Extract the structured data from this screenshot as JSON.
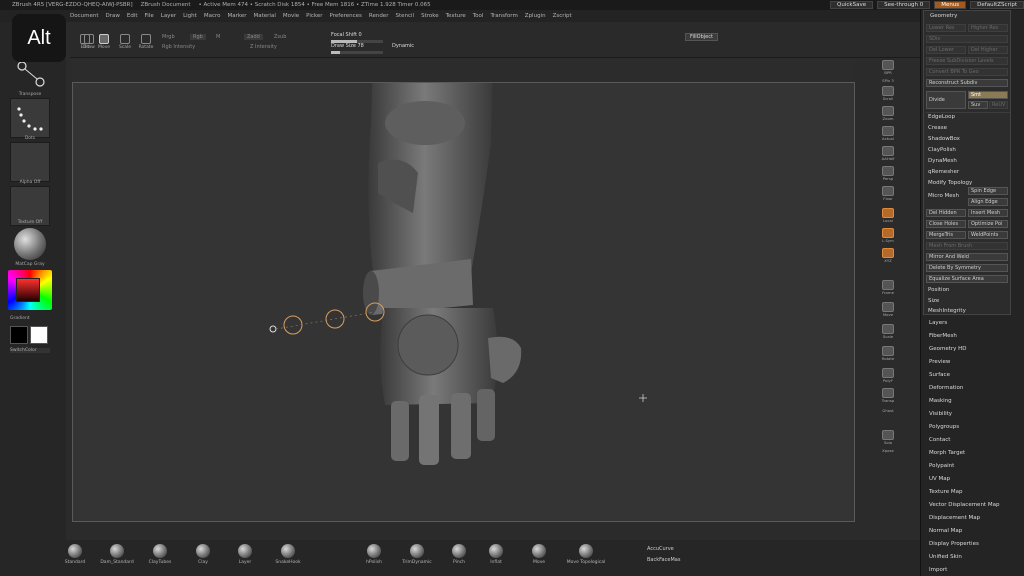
{
  "titlebar": {
    "app": "ZBrush 4R5 [VERG-EZDO-QHEQ-AIWJ-PSBR]",
    "doc": "ZBrush Document",
    "mem": "• Active Mem 474 • Scratch Disk 1854 • Free Mem 1816 • ZTime 1.928 Timer 0.065",
    "quicksave": "QuickSave",
    "seethrough": "See-through 0",
    "menus_btn": "Menus",
    "script": "DefaultZScript"
  },
  "menus": [
    "Document",
    "Draw",
    "Edit",
    "File",
    "Layer",
    "Light",
    "Macro",
    "Marker",
    "Material",
    "Movie",
    "Picker",
    "Preferences",
    "Render",
    "Stencil",
    "Stroke",
    "Texture",
    "Tool",
    "Transform",
    "Zplugin",
    "Zscript"
  ],
  "toolbar": {
    "edit": "Edit",
    "draw": "Draw",
    "move": "Move",
    "scale": "Scale",
    "rotate": "Rotate",
    "mrgb": "Mrgb",
    "rgb": "Rgb",
    "m": "M",
    "zadd": "Zadd",
    "zsub": "Zsub",
    "rgb_intensity": "Rgb Intensity",
    "z_intensity": "Z Intensity",
    "focal_shift": "Focal Shift 0",
    "draw_size": "Draw Size 78",
    "dynamic": "Dynamic",
    "fill_object": "FillObject"
  },
  "alt_key": "Alt",
  "leftshelf": {
    "transpose": "Transpose",
    "dots": "Dots",
    "alpha_off": "Alpha Off",
    "texture_off": "Texture Off",
    "material": "MatCap Gray",
    "gradient": "Gradient",
    "switchcolor": "SwitchColor"
  },
  "rightshelf": [
    "BPR",
    "SPix 3",
    "Scroll",
    "Zoom",
    "Actual",
    "AAHalf",
    "Persp",
    "Floor",
    "Local",
    "L.Sym",
    "XYZ",
    "Frame",
    "Move",
    "Scale",
    "Rotate",
    "PolyF",
    "Transp",
    "Ghost",
    "Solo",
    "Xpose"
  ],
  "geometry": {
    "title": "Geometry",
    "lower_res": "Lower Res",
    "higher_res": "Higher Res",
    "sdiv": "SDiv",
    "del_lower": "Del Lower",
    "del_higher": "Del Higher",
    "freeze": "Freeze SubDivision Levels",
    "convert_bpr": "Convert BPR To Geo",
    "reconstruct": "Reconstruct Subdiv",
    "divide": "Divide",
    "smt": "Smt",
    "suv": "Suv",
    "rsmt": "ReUV",
    "edgeloop": "EdgeLoop",
    "crease": "Crease",
    "shadowbox": "ShadowBox",
    "claypolish": "ClayPolish",
    "dynamesh": "DynaMesh",
    "qremesher": "qRemesher",
    "modify_topology": "Modify Topology",
    "micro_mesh": "Micro Mesh",
    "spin_edge": "Spin Edge",
    "align_edge": "Align Edge",
    "del_hidden": "Del Hidden",
    "insert_mesh": "Insert Mesh",
    "close_holes": "Close Holes",
    "optimize": "Optimize Poi",
    "mergetris": "MergeTris",
    "weldpoints": "WeldPoints",
    "mesh_from_brush": "Mesh From Brush",
    "mirror_weld": "Mirror And Weld",
    "delete_sym": "Delete By Symmetry",
    "equalize": "Equalize Surface Area",
    "position": "Position",
    "size": "Size",
    "meshintegrity": "MeshIntegrity"
  },
  "subpalettes": [
    "Layers",
    "FiberMesh",
    "Geometry HD",
    "Preview",
    "Surface",
    "Deformation",
    "Masking",
    "Visibility",
    "Polygroups",
    "Contact",
    "Morph Target",
    "Polypaint",
    "UV Map",
    "Texture Map",
    "Vector Displacement Map",
    "Displacement Map",
    "Normal Map",
    "Display Properties",
    "Unified Skin",
    "Import"
  ],
  "brushes": [
    "Standard",
    "Dam_Standard",
    "ClayTubes",
    "Clay",
    "Layer",
    "SnakeHook",
    "hPolish",
    "TrimDynamic",
    "Pinch",
    "Inflat",
    "Move",
    "Move Topological"
  ],
  "accucurve": "AccuCurve",
  "backfacemask": "BackFaceMas",
  "colors": {
    "accent": "#b36a2a",
    "bg": "#2b2b2b",
    "canvas": "#343434"
  }
}
